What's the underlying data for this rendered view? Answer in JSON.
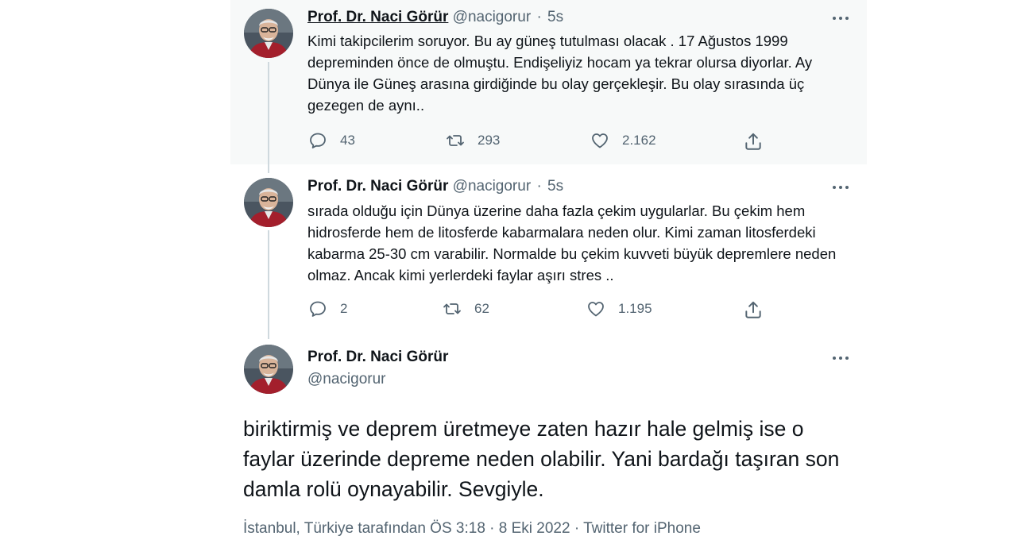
{
  "colors": {
    "text": "#0f1419",
    "muted": "#536471",
    "thread_line": "#cfd9de",
    "highlight_bg": "#f7f9f9"
  },
  "author": {
    "name": "Prof. Dr. Naci Görür",
    "handle": "@nacigorur"
  },
  "tweets": [
    {
      "time": "5s",
      "text": "Kimi takipcilerim soruyor. Bu ay güneş tutulması olacak . 17 Ağustos 1999 depreminden önce de olmuştu. Endişeliyiz hocam ya tekrar olursa diyorlar. Ay Dünya ile Güneş arasına girdiğinde bu olay gerçekleşir. Bu olay sırasında üç gezegen de aynı..",
      "replies": "43",
      "retweets": "293",
      "likes": "2.162"
    },
    {
      "time": "5s",
      "text": "sırada olduğu için Dünya üzerine daha fazla çekim uygularlar. Bu çekim hem hidrosferde hem de litosferde kabarmalara neden olur. Kimi zaman litosferdeki kabarma 25-30 cm varabilir. Normalde bu çekim kuvveti büyük depremlere neden olmaz. Ancak kimi yerlerdeki faylar aşırı stres ..",
      "replies": "2",
      "retweets": "62",
      "likes": "1.195"
    }
  ],
  "main_tweet": {
    "text": "biriktirmiş ve deprem üretmeye zaten hazır hale gelmiş ise o faylar üzerinde depreme neden olabilir. Yani bardağı taşıran son damla rolü oynayabilir. Sevgiyle.",
    "meta": "İstanbul, Türkiye tarafından ÖS 3:18 · 8 Eki 2022 · Twitter for iPhone"
  },
  "icons": {
    "more": "more-horizontal-icon",
    "reply": "reply-icon",
    "retweet": "retweet-icon",
    "like": "heart-icon",
    "share": "share-icon"
  }
}
